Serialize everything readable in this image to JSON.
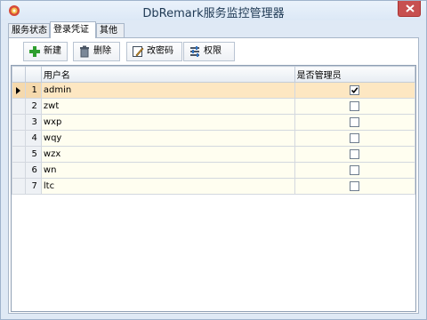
{
  "window": {
    "title": "DbRemark服务监控管理器"
  },
  "tabs": [
    {
      "label": "服务状态",
      "active": false
    },
    {
      "label": "登录凭证",
      "active": true
    },
    {
      "label": "其他",
      "active": false
    }
  ],
  "toolbar": {
    "new_label": "新建",
    "delete_label": "删除",
    "change_password_label": "改密码",
    "permissions_label": "权限"
  },
  "grid": {
    "columns": {
      "username": "用户名",
      "is_admin": "是否管理员"
    },
    "rows": [
      {
        "num": "1",
        "username": "admin",
        "is_admin": true,
        "selected": true
      },
      {
        "num": "2",
        "username": "zwt",
        "is_admin": false,
        "selected": false
      },
      {
        "num": "3",
        "username": "wxp",
        "is_admin": false,
        "selected": false
      },
      {
        "num": "4",
        "username": "wqy",
        "is_admin": false,
        "selected": false
      },
      {
        "num": "5",
        "username": "wzx",
        "is_admin": false,
        "selected": false
      },
      {
        "num": "6",
        "username": "wn",
        "is_admin": false,
        "selected": false
      },
      {
        "num": "7",
        "username": "ltc",
        "is_admin": false,
        "selected": false
      }
    ]
  },
  "icons": {
    "app": "gear-app-icon",
    "close": "close-icon",
    "new": "plus-icon",
    "delete": "trash-icon",
    "change_password": "edit-icon",
    "permissions": "permissions-icon"
  },
  "colors": {
    "selected_row": "#fde7c2",
    "row_bg": "#fffef0",
    "close_button": "#c75050",
    "new_icon": "#2e9e2e"
  }
}
